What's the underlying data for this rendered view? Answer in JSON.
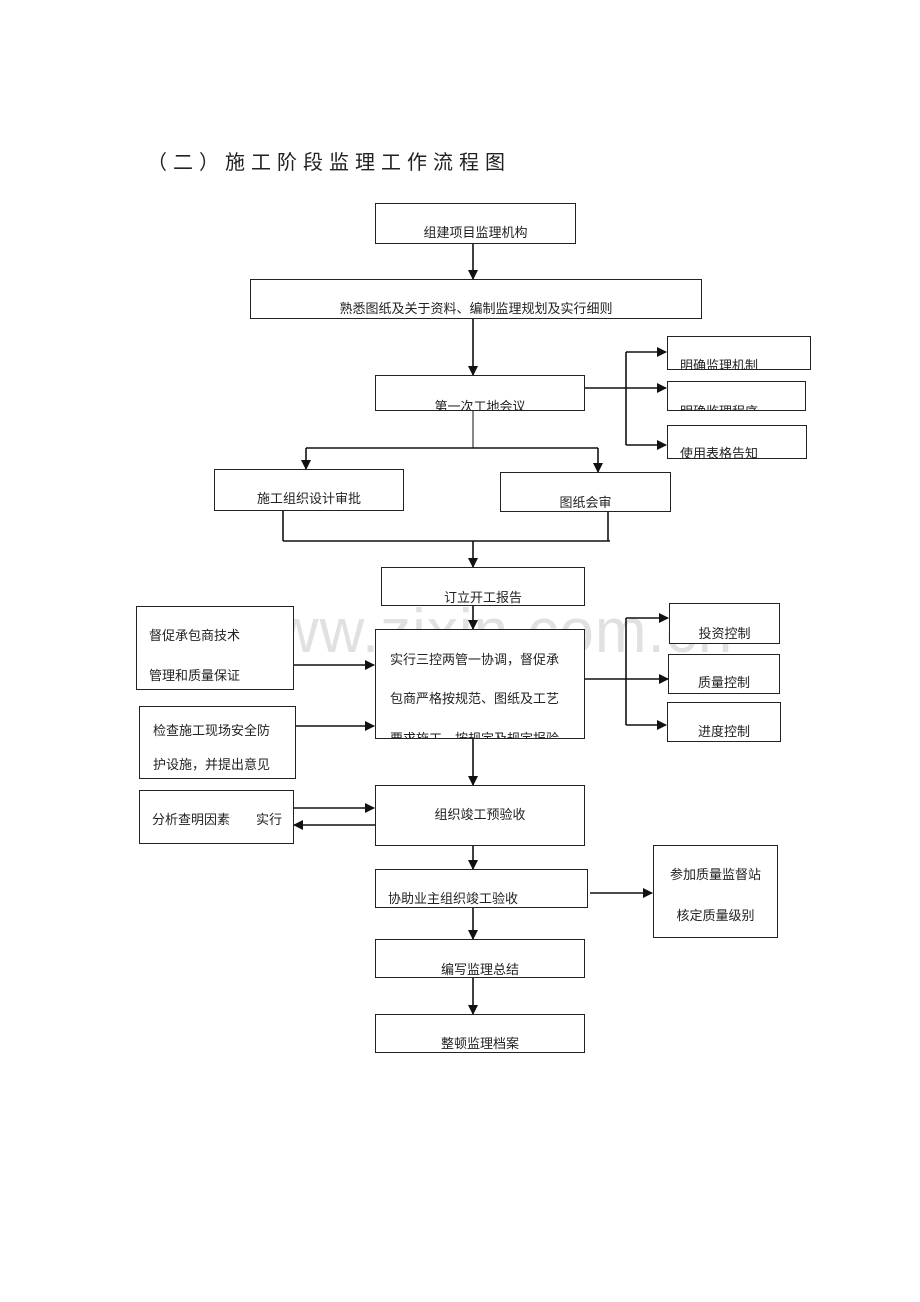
{
  "title": "（二）施工阶段监理工作流程图",
  "watermark": "www.zixin.com.cn",
  "nodes": {
    "org_setup": "组建项目监理机构",
    "familiarize": "熟悉图纸及关于资料、编制监理规划及实行细则",
    "first_meeting": "第一次工地会议",
    "clarify_mechanism": "明确监理机制",
    "clarify_procedure": "明确监理程序",
    "use_forms": "使用表格告知",
    "construction_design_approval": "施工组织设计审批",
    "drawing_review": "图纸会审",
    "start_report": "订立开工报告",
    "supervise_contractor": [
      "督促承包商技术",
      "管理和质量保证"
    ],
    "safety_check": [
      "检查施工现场安全防",
      "护设施，并提出意见"
    ],
    "three_controls": [
      "实行三控两管一协调，督促承",
      "包商严格按规范、图纸及工艺",
      "要求施工，按规定及规定报验"
    ],
    "investment_control": "投资控制",
    "quality_control": "质量控制",
    "schedule_control": "进度控制",
    "analyze_causes": "分析查明因素　　实行",
    "pre_acceptance": "组织竣工预验收",
    "assist_acceptance": "协助业主组织竣工验收",
    "quality_station": [
      "参加质量监督站",
      "核定质量级别"
    ],
    "write_summary": "编写监理总结",
    "archive": "整顿监理档案"
  }
}
